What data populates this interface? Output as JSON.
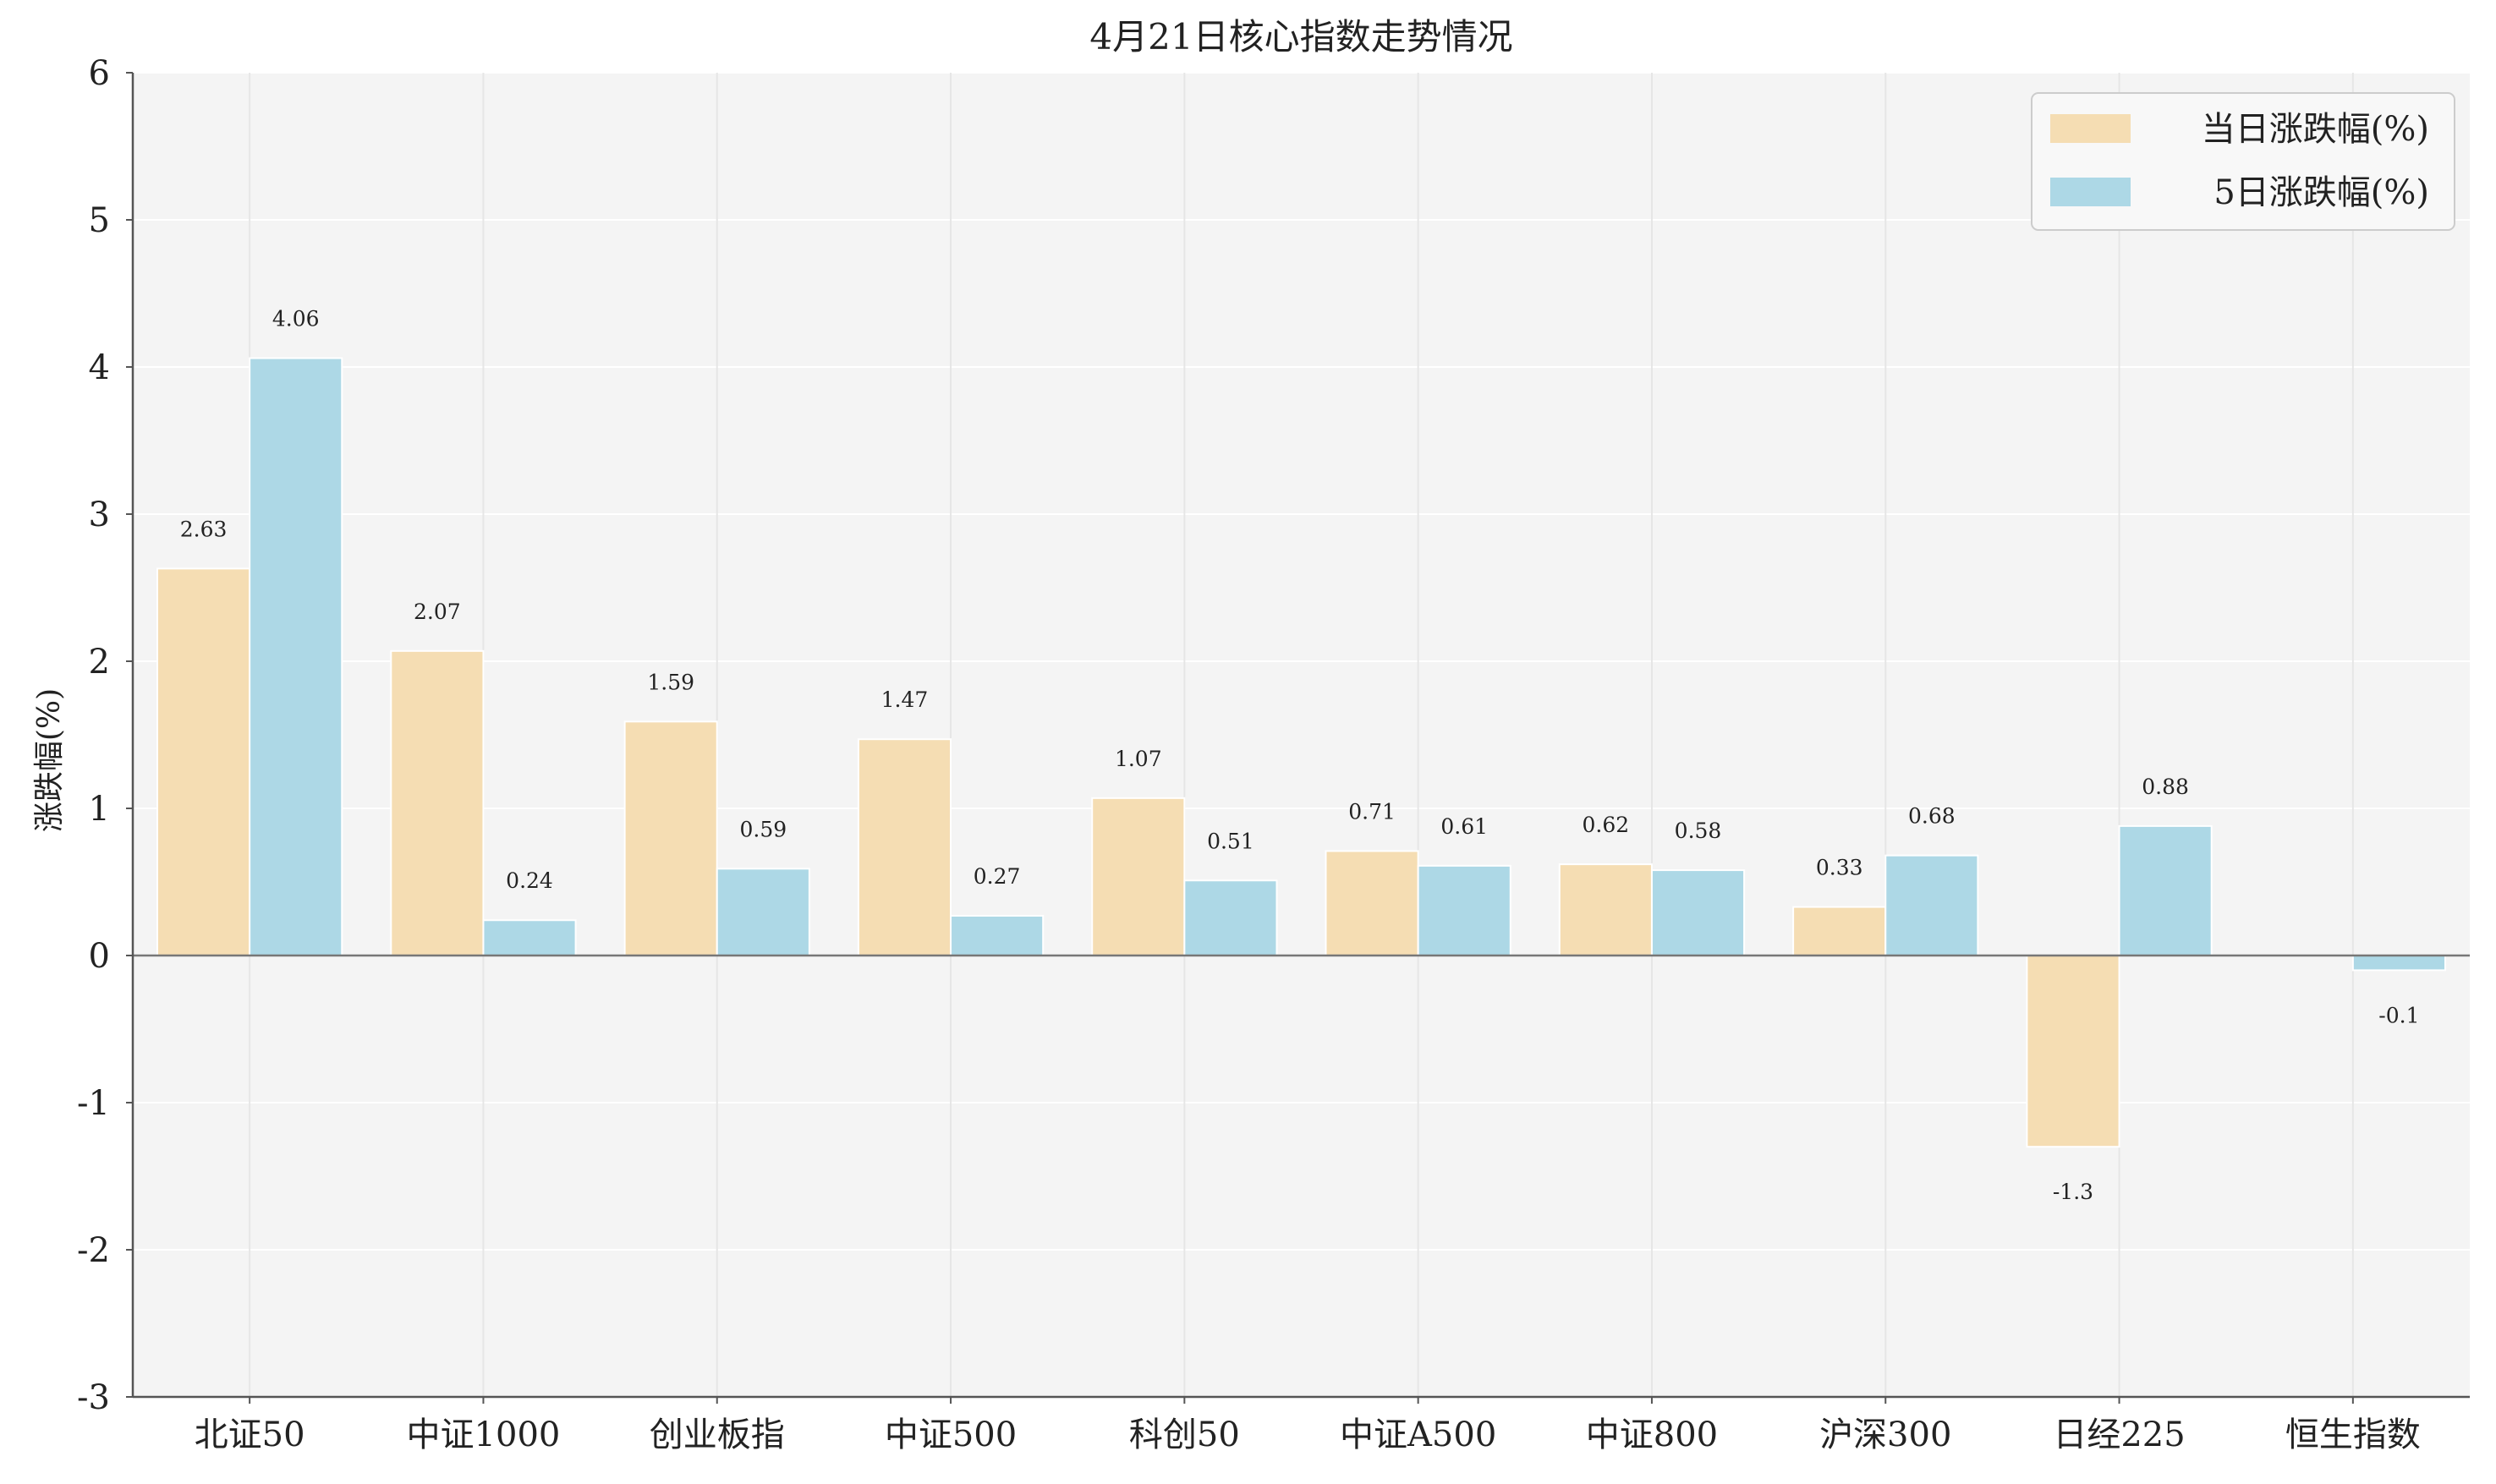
{
  "chart_data": {
    "type": "bar",
    "title": "4月21日核心指数走势情况",
    "xlabel": "",
    "ylabel": "涨跌幅(%)",
    "ylim": [
      -3,
      6
    ],
    "yticks": [
      -3,
      -2,
      -1,
      0,
      1,
      2,
      3,
      4,
      5,
      6
    ],
    "grid": true,
    "legend_position": "top-right",
    "categories": [
      "北证50",
      "中证1000",
      "创业板指",
      "中证500",
      "科创50",
      "中证A500",
      "中证800",
      "沪深300",
      "日经225",
      "恒生指数"
    ],
    "series": [
      {
        "name": "当日涨跌幅(%)",
        "color": "#f5ddb3",
        "values": [
          2.63,
          2.07,
          1.59,
          1.47,
          1.07,
          0.71,
          0.62,
          0.33,
          -1.3,
          null
        ],
        "labels": [
          "2.63",
          "2.07",
          "1.59",
          "1.47",
          "1.07",
          "0.71",
          "0.62",
          "0.33",
          "-1.3",
          ""
        ]
      },
      {
        "name": "5日涨跌幅(%)",
        "color": "#add8e6",
        "values": [
          4.06,
          0.24,
          0.59,
          0.27,
          0.51,
          0.61,
          0.58,
          0.68,
          0.88,
          -0.1
        ],
        "labels": [
          "4.06",
          "0.24",
          "0.59",
          "0.27",
          "0.51",
          "0.61",
          "0.58",
          "0.68",
          "0.88",
          "-0.1"
        ]
      }
    ],
    "colors": {
      "plot_background": "#f4f4f4",
      "grid": "#e6e6e6",
      "axis": "#555555",
      "zero_line": "#777777"
    }
  }
}
